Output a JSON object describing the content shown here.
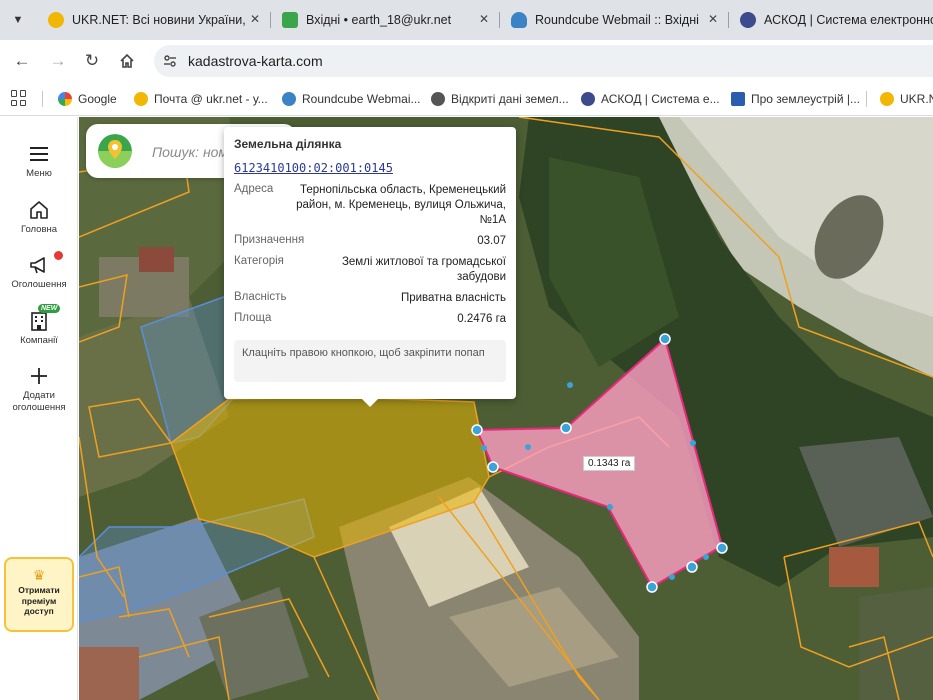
{
  "tabs": [
    {
      "title": "UKR.NET: Всі новини України, ",
      "active": false,
      "favicon_color": "#f2b705"
    },
    {
      "title": "Вхідні • earth_18@ukr.net",
      "active": false,
      "favicon_color": "#3aa54a"
    },
    {
      "title": "Roundcube Webmail :: Вхідні",
      "active": false,
      "favicon_color": "#3b83c5"
    },
    {
      "title": "АСКОД | Система електронно",
      "active": false,
      "favicon_color": "#3b4b8c"
    }
  ],
  "address": {
    "url": "kadastrova-karta.com"
  },
  "bookmarks": [
    {
      "label": "Google",
      "color": "#4285f4"
    },
    {
      "label": "Почта @ ukr.net - у...",
      "color": "#f2b705"
    },
    {
      "label": "Roundcube Webmai...",
      "color": "#3b83c5"
    },
    {
      "label": "Відкриті дані земел...",
      "color": "#555555"
    },
    {
      "label": "АСКОД | Система е...",
      "color": "#3b4b8c"
    },
    {
      "label": "Про землеустрій |...",
      "color": "#2a5db0"
    },
    {
      "label": "UKR.N",
      "color": "#f2b705"
    }
  ],
  "sidebar": {
    "items": [
      {
        "label": "Меню",
        "icon": "hamburger-icon"
      },
      {
        "label": "Головна",
        "icon": "home-icon"
      },
      {
        "label": "Оголошення",
        "icon": "megaphone-icon"
      },
      {
        "label": "Компанії",
        "icon": "building-icon",
        "badge": "NEW"
      },
      {
        "label": "Додати оголошення",
        "icon": "plus-icon"
      }
    ],
    "premium": {
      "line1": "Отримати",
      "line2": "преміум",
      "line3": "доступ"
    }
  },
  "search": {
    "placeholder": "Пошук: ном"
  },
  "popup": {
    "title": "Земельна ділянка",
    "cadastral_number": "6123410100:02:001:0145",
    "rows": [
      {
        "key": "Адреса",
        "value": "Тернопільська область, Кременецький район, м. Кременець, вулиця Ольжича, №1А"
      },
      {
        "key": "Призначення",
        "value": "03.07"
      },
      {
        "key": "Категорія",
        "value": "Землі житлової та громадської забудови"
      },
      {
        "key": "Власність",
        "value": "Приватна власність"
      },
      {
        "key": "Площа",
        "value": "0.2476 га"
      }
    ],
    "hint": "Клацніть правою кнопкою, щоб закріпити попап"
  },
  "measurement": {
    "area_label": "0.1343 га"
  },
  "colors": {
    "parcel_outline": "#f0a020",
    "selected_parcel": "#e8b400",
    "measure_fill": "#ff9fc4",
    "measure_stroke": "#e8287a",
    "vertex": "#3aa3d8",
    "blue_parcel": "#5a8fd8"
  }
}
